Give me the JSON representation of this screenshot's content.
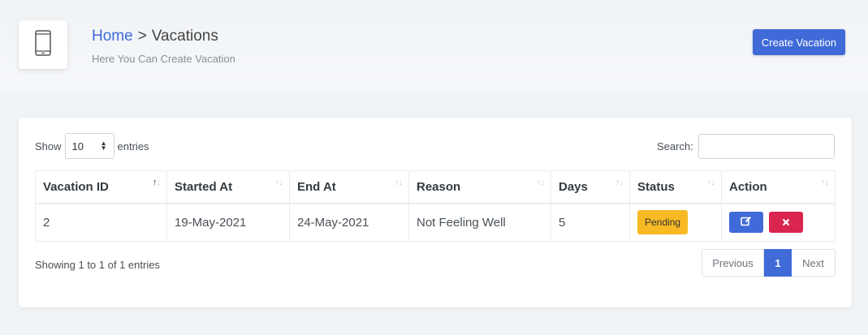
{
  "header": {
    "breadcrumb_home": "Home",
    "breadcrumb_separator": ">",
    "breadcrumb_current": "Vacations",
    "subtitle": "Here You Can Create Vacation",
    "create_button_label": "Create Vacation",
    "icon": "mobile-phone-icon"
  },
  "table_controls": {
    "show_label": "Show",
    "entries_label": "entries",
    "page_length_value": "10",
    "search_label": "Search:",
    "search_value": ""
  },
  "table": {
    "columns": [
      "Vacation ID",
      "Started At",
      "End At",
      "Reason",
      "Days",
      "Status",
      "Action"
    ],
    "rows": [
      {
        "vacation_id": "2",
        "started_at": "19-May-2021",
        "end_at": "24-May-2021",
        "reason": "Not Feeling Well",
        "days": "5",
        "status": "Pending"
      }
    ]
  },
  "footer": {
    "info": "Showing 1 to 1 of 1 entries",
    "prev_label": "Previous",
    "current_page": "1",
    "next_label": "Next"
  },
  "colors": {
    "primary": "#3f6ad8",
    "warning": "#f7b924",
    "danger": "#d92550"
  }
}
